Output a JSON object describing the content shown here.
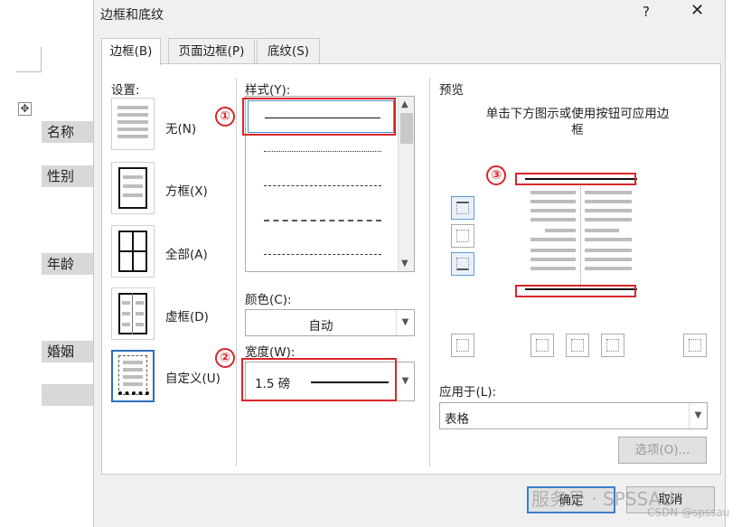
{
  "document": {
    "cells": [
      "名称",
      "性别",
      "年龄",
      "婚姻"
    ]
  },
  "dialog": {
    "title": "边框和底纹",
    "help": "?",
    "close": "✕",
    "tabs": [
      "边框(B)",
      "页面边框(P)",
      "底纹(S)"
    ],
    "setting_label": "设置:",
    "settings": [
      "无(N)",
      "方框(X)",
      "全部(A)",
      "虚框(D)",
      "自定义(U)"
    ],
    "style_label": "样式(Y):",
    "color_label": "颜色(C):",
    "color_value": "自动",
    "width_label": "宽度(W):",
    "width_value": "1.5 磅",
    "preview_label": "预览",
    "preview_hint": "单击下方图示或使用按钮可应用边框",
    "apply_label": "应用于(L):",
    "apply_value": "表格",
    "options_button": "选项(O)...",
    "ok_button": "确定",
    "cancel_button": "取消"
  },
  "annotations": {
    "m1": "①",
    "m2": "②",
    "m3": "③",
    "accent_color": "#d9262a"
  },
  "watermark": {
    "main": "服务号 · SPSSAU",
    "sub": "CSDN @spssau"
  }
}
